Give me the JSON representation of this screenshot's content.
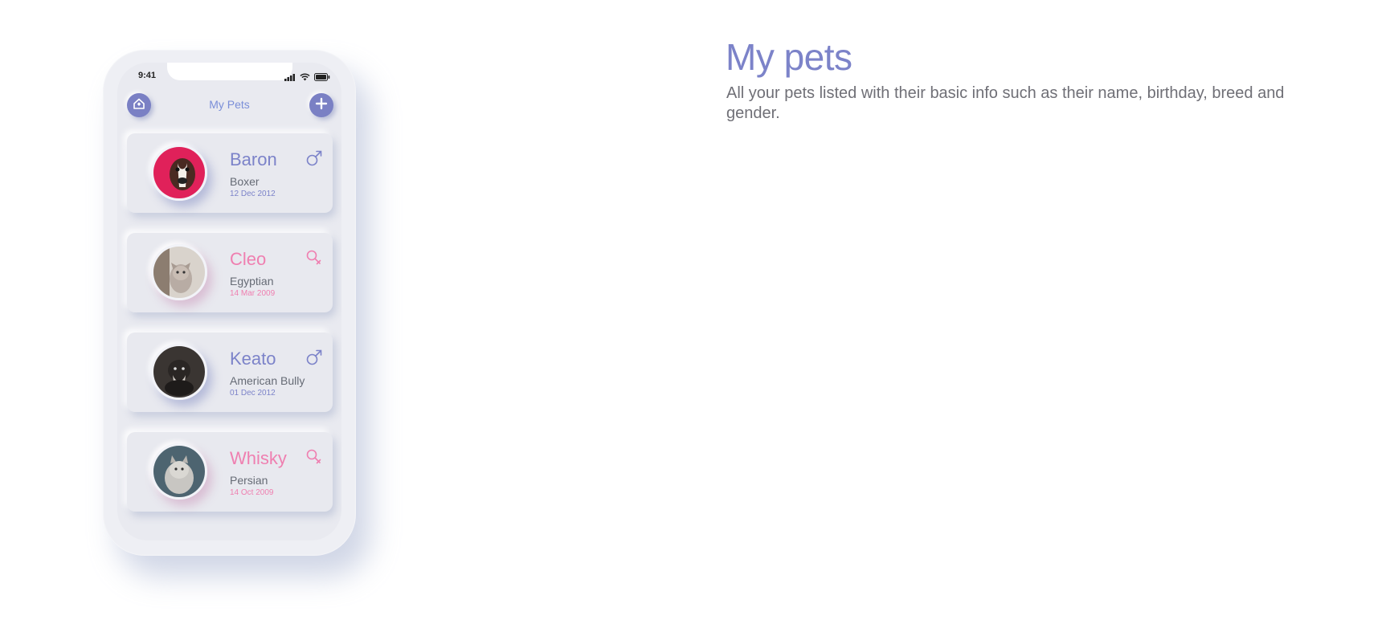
{
  "phone": {
    "status_time": "9:41",
    "header_title": "My Pets",
    "icons": {
      "home": "home-icon",
      "add": "plus-icon"
    }
  },
  "pets": [
    {
      "name": "Baron",
      "breed": "Boxer",
      "birthday": "12 Dec 2012",
      "gender": "male",
      "gender_icon": "male-icon"
    },
    {
      "name": "Cleo",
      "breed": "Egyptian",
      "birthday": "14 Mar 2009",
      "gender": "female",
      "gender_icon": "female-icon"
    },
    {
      "name": "Keato",
      "breed": "American Bully",
      "birthday": "01 Dec 2012",
      "gender": "male",
      "gender_icon": "male-icon"
    },
    {
      "name": "Whisky",
      "breed": "Persian",
      "birthday": "14 Oct 2009",
      "gender": "female",
      "gender_icon": "female-icon"
    }
  ],
  "info": {
    "title": "My pets",
    "description": "All your pets listed with their basic info such as their name, birthday, breed and gender."
  },
  "colors": {
    "accent": "#7c83c9",
    "female": "#ef7fb0",
    "male": "#7c83c9",
    "background": "#e9eaf0"
  }
}
